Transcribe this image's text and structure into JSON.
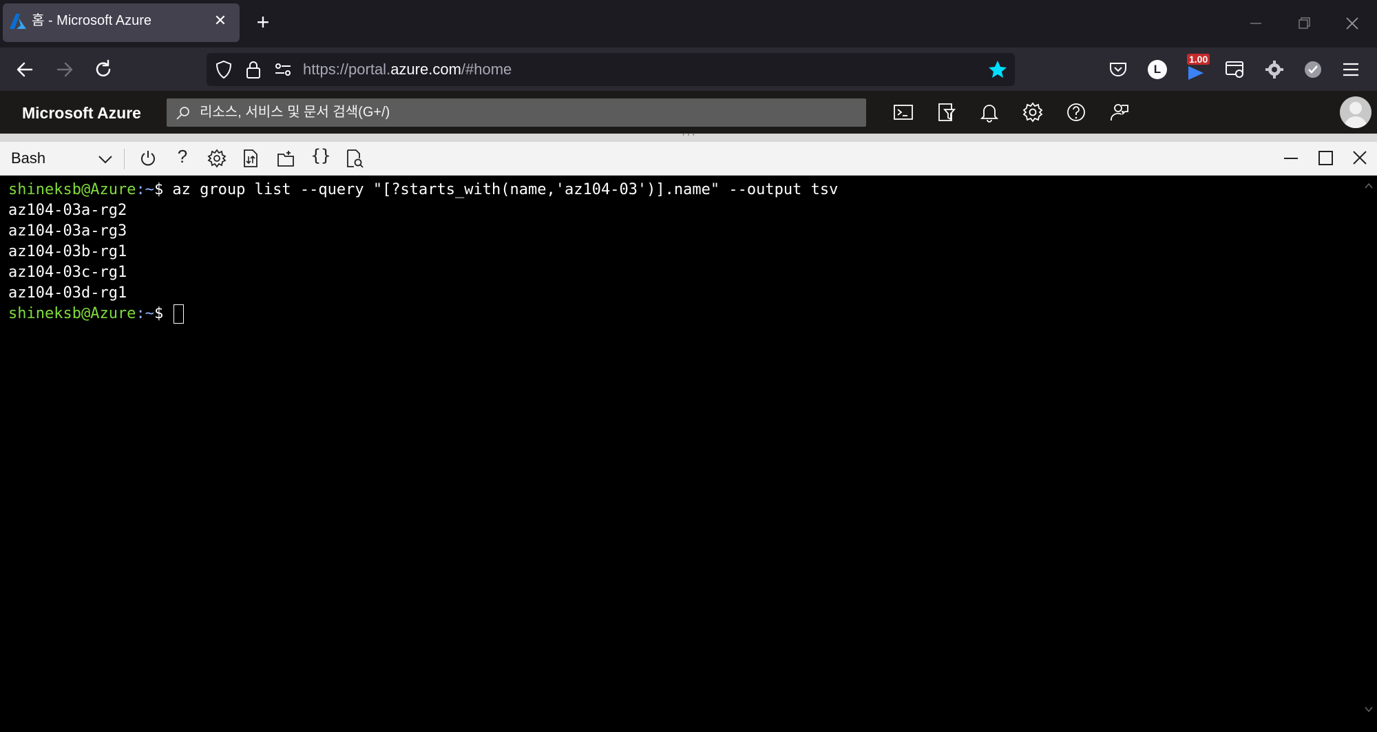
{
  "browser": {
    "tab": {
      "title": "홈 - Microsoft Azure",
      "close": "✕"
    },
    "new_tab": "+",
    "url": {
      "prefix": "https://portal.",
      "domain": "azure.com",
      "suffix": "/#home"
    },
    "extensions": [
      {
        "name": "pocket-icon"
      },
      {
        "name": "profile-L-icon",
        "label": "L"
      },
      {
        "name": "video-speed-icon",
        "badge": "1.00"
      },
      {
        "name": "screen-capture-icon"
      },
      {
        "name": "settings-extension-icon"
      },
      {
        "name": "check-extension-icon"
      },
      {
        "name": "menu-icon"
      }
    ],
    "accent": "#00ddff"
  },
  "azure": {
    "brand": "Microsoft Azure",
    "search_placeholder": "리소스, 서비스 및 문서 검색(G+/)",
    "header_icons": [
      "cloud-shell-icon",
      "directory-filter-icon",
      "notifications-icon",
      "settings-icon",
      "help-icon",
      "feedback-icon"
    ]
  },
  "shell": {
    "type": "Bash",
    "toolbar_icons": [
      "restart-icon",
      "help-icon",
      "settings-icon",
      "upload-download-icon",
      "open-new-session-icon",
      "editor-braces-icon",
      "web-preview-icon"
    ],
    "window_controls": [
      "minimize-icon",
      "maximize-icon",
      "close-icon"
    ]
  },
  "terminal": {
    "user": "shineksb@Azure",
    "path": ":~",
    "prompt_symbol": "$",
    "command": " az group list --query \"[?starts_with(name,'az104-03')].name\" --output tsv",
    "output": [
      "az104-03a-rg2",
      "az104-03a-rg3",
      "az104-03b-rg1",
      "az104-03c-rg1",
      "az104-03d-rg1"
    ],
    "user_color": "#7fdc3c",
    "path_color": "#8fb3ff"
  }
}
